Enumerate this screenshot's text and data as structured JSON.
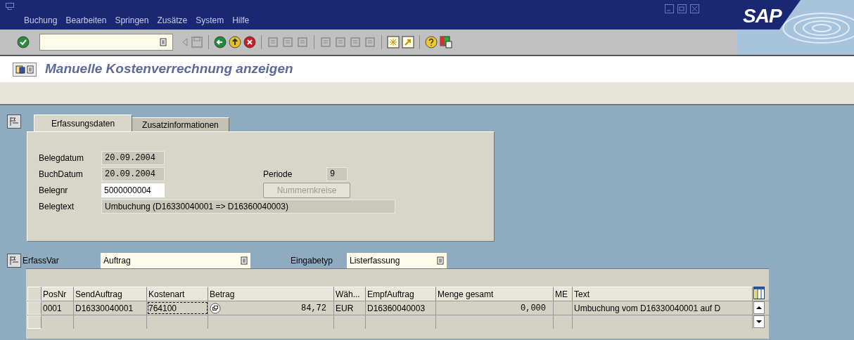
{
  "menu": [
    "Buchung",
    "Bearbeiten",
    "Springen",
    "Zusätze",
    "System",
    "Hilfe"
  ],
  "logo": "SAP",
  "screen_title": "Manuelle Kostenverrechnung anzeigen",
  "tabs": [
    {
      "label": "Erfassungsdaten",
      "selected": true
    },
    {
      "label": "Zusatzinformationen",
      "selected": false
    }
  ],
  "header_fields": [
    {
      "label": "Belegdatum",
      "value": "20.09.2004",
      "editable": false,
      "mono": true
    },
    {
      "label": "BuchDatum",
      "value": "20.09.2004",
      "editable": false,
      "mono": true
    },
    {
      "label": "Belegnr",
      "value": "5000000004",
      "editable": true,
      "mono": false
    },
    {
      "label": "Belegtext",
      "value": "Umbuchung (D16330040001 => D16360040003)",
      "editable": false,
      "mono": false
    }
  ],
  "periode": {
    "label": "Periode",
    "value": "9"
  },
  "nummernkreise_button": {
    "label": "Nummernkreise",
    "disabled": true
  },
  "erfassvar": {
    "label": "ErfassVar",
    "value": "Auftrag"
  },
  "eingabetyp": {
    "label": "Eingabetyp",
    "value": "Listerfassung"
  },
  "table": {
    "columns": [
      "PosNr",
      "SendAuftrag",
      "Kostenart",
      "Betrag",
      "Wäh...",
      "EmpfAuftrag",
      "Menge gesamt",
      "ME",
      "Text"
    ],
    "rows": [
      {
        "cells": [
          {
            "text": "0001",
            "focused": false
          },
          {
            "text": "D16330040001",
            "focused": false
          },
          {
            "text": "764100",
            "focused": true
          },
          {
            "text": "84,72",
            "focused": false
          },
          {
            "text": "EUR",
            "focused": false
          },
          {
            "text": "D16360040003",
            "focused": false
          },
          {
            "text": "0,000",
            "focused": false
          },
          {
            "text": "",
            "focused": false
          },
          {
            "text": "Umbuchung vom D16330040001 auf D",
            "focused": false
          }
        ]
      }
    ]
  }
}
